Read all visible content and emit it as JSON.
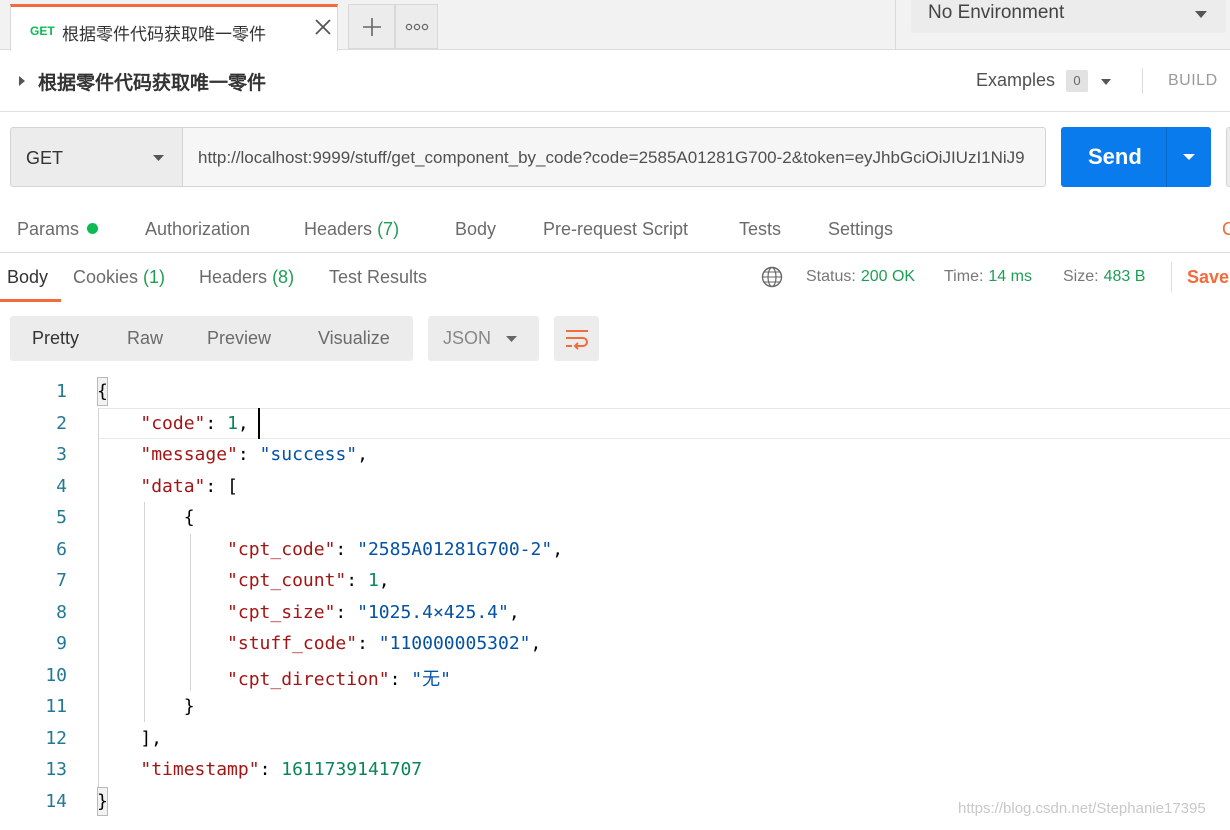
{
  "tab": {
    "method": "GET",
    "title": "根据零件代码获取唯一零件"
  },
  "environment": {
    "selected": "No Environment"
  },
  "request": {
    "name": "根据零件代码获取唯一零件",
    "examples_label": "Examples",
    "examples_count": "0",
    "build_label": "BUILD",
    "method": "GET",
    "url": "http://localhost:9999/stuff/get_component_by_code?code=2585A01281G700-2&token=eyJhbGciOiJIUzI1NiJ9",
    "send_label": "Send"
  },
  "request_tabs": {
    "params": "Params",
    "authorization": "Authorization",
    "headers": "Headers",
    "headers_count": "(7)",
    "body": "Body",
    "prerequest": "Pre-request Script",
    "tests": "Tests",
    "settings": "Settings",
    "cookies_cut": "C"
  },
  "response_tabs": {
    "body": "Body",
    "cookies": "Cookies",
    "cookies_count": "(1)",
    "headers": "Headers",
    "headers_count": "(8)",
    "test_results": "Test Results"
  },
  "response_meta": {
    "status_label": "Status:",
    "status_value": "200 OK",
    "time_label": "Time:",
    "time_value": "14 ms",
    "size_label": "Size:",
    "size_value": "483 B",
    "save_label": "Save"
  },
  "view": {
    "pretty": "Pretty",
    "raw": "Raw",
    "preview": "Preview",
    "visualize": "Visualize",
    "format": "JSON"
  },
  "code_lines": [
    {
      "n": "1",
      "parts": [
        [
          "p",
          "{"
        ]
      ]
    },
    {
      "n": "2",
      "parts": [
        [
          "p",
          "    "
        ],
        [
          "k",
          "\"code\""
        ],
        [
          "p",
          ": "
        ],
        [
          "n",
          "1"
        ],
        [
          "p",
          ","
        ]
      ]
    },
    {
      "n": "3",
      "parts": [
        [
          "p",
          "    "
        ],
        [
          "k",
          "\"message\""
        ],
        [
          "p",
          ": "
        ],
        [
          "s",
          "\"success\""
        ],
        [
          "p",
          ","
        ]
      ]
    },
    {
      "n": "4",
      "parts": [
        [
          "p",
          "    "
        ],
        [
          "k",
          "\"data\""
        ],
        [
          "p",
          ": ["
        ]
      ]
    },
    {
      "n": "5",
      "parts": [
        [
          "p",
          "        {"
        ]
      ]
    },
    {
      "n": "6",
      "parts": [
        [
          "p",
          "            "
        ],
        [
          "k",
          "\"cpt_code\""
        ],
        [
          "p",
          ": "
        ],
        [
          "s",
          "\"2585A01281G700-2\""
        ],
        [
          "p",
          ","
        ]
      ]
    },
    {
      "n": "7",
      "parts": [
        [
          "p",
          "            "
        ],
        [
          "k",
          "\"cpt_count\""
        ],
        [
          "p",
          ": "
        ],
        [
          "n",
          "1"
        ],
        [
          "p",
          ","
        ]
      ]
    },
    {
      "n": "8",
      "parts": [
        [
          "p",
          "            "
        ],
        [
          "k",
          "\"cpt_size\""
        ],
        [
          "p",
          ": "
        ],
        [
          "s",
          "\"1025.4×425.4\""
        ],
        [
          "p",
          ","
        ]
      ]
    },
    {
      "n": "9",
      "parts": [
        [
          "p",
          "            "
        ],
        [
          "k",
          "\"stuff_code\""
        ],
        [
          "p",
          ": "
        ],
        [
          "s",
          "\"110000005302\""
        ],
        [
          "p",
          ","
        ]
      ]
    },
    {
      "n": "10",
      "parts": [
        [
          "p",
          "            "
        ],
        [
          "k",
          "\"cpt_direction\""
        ],
        [
          "p",
          ": "
        ],
        [
          "s",
          "\"无\""
        ]
      ]
    },
    {
      "n": "11",
      "parts": [
        [
          "p",
          "        }"
        ]
      ]
    },
    {
      "n": "12",
      "parts": [
        [
          "p",
          "    ],"
        ]
      ]
    },
    {
      "n": "13",
      "parts": [
        [
          "p",
          "    "
        ],
        [
          "k",
          "\"timestamp\""
        ],
        [
          "p",
          ": "
        ],
        [
          "n",
          "1611739141707"
        ]
      ]
    },
    {
      "n": "14",
      "parts": [
        [
          "p",
          "}"
        ]
      ]
    }
  ],
  "watermark": "https://blog.csdn.net/Stephanie17395",
  "colors": {
    "accent_orange": "#f26b3a",
    "send_blue": "#097bed",
    "status_green": "#1e9e55",
    "get_green": "#0cbb52"
  }
}
